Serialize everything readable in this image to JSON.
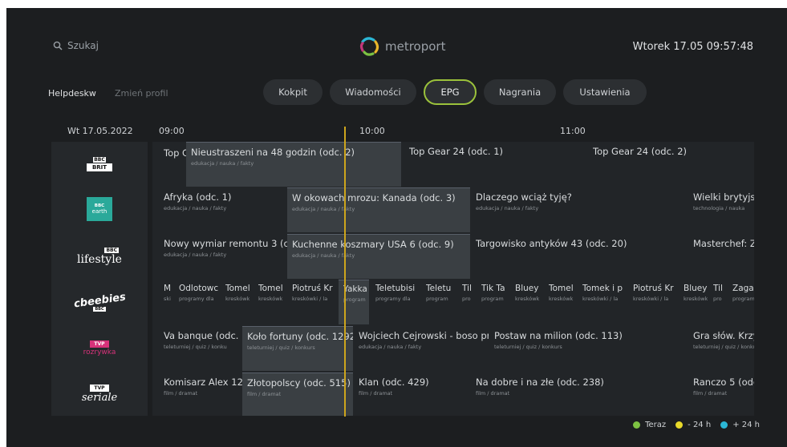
{
  "header": {
    "search_placeholder": "Szukaj",
    "brand_name": "metroport",
    "datetime": "Wtorek 17.05 09:57:48"
  },
  "profile": {
    "name": "Helpdeskw",
    "switch_label": "Zmień profil"
  },
  "nav": {
    "tabs": [
      "Kokpit",
      "Wiadomości",
      "EPG",
      "Nagrania",
      "Ustawienia"
    ],
    "active": "EPG"
  },
  "timeline": {
    "date": "Wt 17.05.2022",
    "times": [
      "09:00",
      "10:00",
      "11:00"
    ]
  },
  "channels": [
    {
      "logo": [
        "BBC",
        "BRIT"
      ],
      "programs": [
        {
          "title": "Top G",
          "cat": ""
        },
        {
          "title": "Nieustraszeni na 48 godzin (odc. 2)",
          "cat": "edukacja / nauka / fakty",
          "current": true
        },
        {
          "title": "Top Gear 24 (odc. 1)",
          "cat": ""
        },
        {
          "title": "Top Gear 24 (odc. 2)",
          "cat": ""
        }
      ]
    },
    {
      "logo": [
        "BBC",
        "earth"
      ],
      "programs": [
        {
          "title": "Afryka (odc. 1)",
          "cat": "edukacja / nauka / fakty"
        },
        {
          "title": "W okowach mrozu: Kanada (odc. 3)",
          "cat": "edukacja / nauka / fakty",
          "current": true
        },
        {
          "title": "Dlaczego wciąż tyję?",
          "cat": "edukacja / nauka / fakty"
        },
        {
          "title": "Wielki brytyjsk",
          "cat": "technologia / nauka"
        }
      ]
    },
    {
      "logo": [
        "BBC",
        "lifestyle"
      ],
      "programs": [
        {
          "title": "Nowy wymiar remontu 3 (odc",
          "cat": "edukacja / nauka / fakty"
        },
        {
          "title": "Kuchenne koszmary USA 6 (odc. 9)",
          "cat": "edukacja / nauka / fakty",
          "current": true
        },
        {
          "title": "Targowisko antyków 43 (odc. 20)",
          "cat": ""
        },
        {
          "title": "Masterchef: Z",
          "cat": ""
        }
      ]
    },
    {
      "logo": [
        "cbeebies",
        "BBC"
      ],
      "programs": [
        {
          "title": "M",
          "cat": "ski"
        },
        {
          "title": "Odlotowc",
          "cat": "programy dla"
        },
        {
          "title": "Tomel",
          "cat": "kreskówk"
        },
        {
          "title": "Tomel",
          "cat": "kreskówk"
        },
        {
          "title": "Piotruś Kr",
          "cat": "kreskówki / la"
        },
        {
          "title": "Yakka",
          "cat": "program",
          "current": true
        },
        {
          "title": "Teletubisi",
          "cat": "programy dla"
        },
        {
          "title": "Teletu",
          "cat": "program"
        },
        {
          "title": "Til",
          "cat": "pro"
        },
        {
          "title": "Tik Ta",
          "cat": "program"
        },
        {
          "title": "Bluey",
          "cat": "kreskówk"
        },
        {
          "title": "Tomel",
          "cat": "kreskówk"
        },
        {
          "title": "Tomek i p",
          "cat": "kreskówki / la"
        },
        {
          "title": "Piotruś Kr",
          "cat": "kreskówki / la"
        },
        {
          "title": "Bluey",
          "cat": "kreskówk"
        },
        {
          "title": "Til",
          "cat": "pro"
        },
        {
          "title": "Zagad",
          "cat": "program"
        }
      ]
    },
    {
      "logo": [
        "TVP",
        "rozrywka"
      ],
      "programs": [
        {
          "title": "Va banque (odc. 1",
          "cat": "teleturniej / quiz / konku"
        },
        {
          "title": "Koło fortuny (odc. 1292)",
          "cat": "teleturniej / quiz / konkurs",
          "current": true
        },
        {
          "title": "Wojciech Cejrowski - boso pr",
          "cat": "edukacja / nauka / fakty"
        },
        {
          "title": "Postaw na milion (odc. 113)",
          "cat": "teleturniej / quiz / konkurs"
        },
        {
          "title": "Gra słów. Krzyżów",
          "cat": "teleturniej / quiz / konku"
        }
      ]
    },
    {
      "logo": [
        "TVP",
        "seriale"
      ],
      "programs": [
        {
          "title": "Komisarz Alex 12",
          "cat": "film / dramat"
        },
        {
          "title": "Złotopolscy (odc. 515)",
          "cat": "film / dramat",
          "current": true
        },
        {
          "title": "Klan (odc. 429)",
          "cat": "film / dramat"
        },
        {
          "title": "Na dobre i na złe (odc. 238)",
          "cat": "film / dramat"
        },
        {
          "title": "Ranczo 5 (odc. 64",
          "cat": "film / dramat"
        }
      ]
    }
  ],
  "legend": [
    {
      "label": "Teraz",
      "color": "#7dc242"
    },
    {
      "label": "- 24 h",
      "color": "#e8d92a"
    },
    {
      "label": "+ 24 h",
      "color": "#2bb7d6"
    }
  ],
  "colors": {
    "accent": "#9bc23b",
    "now_line": "#cda51d"
  }
}
